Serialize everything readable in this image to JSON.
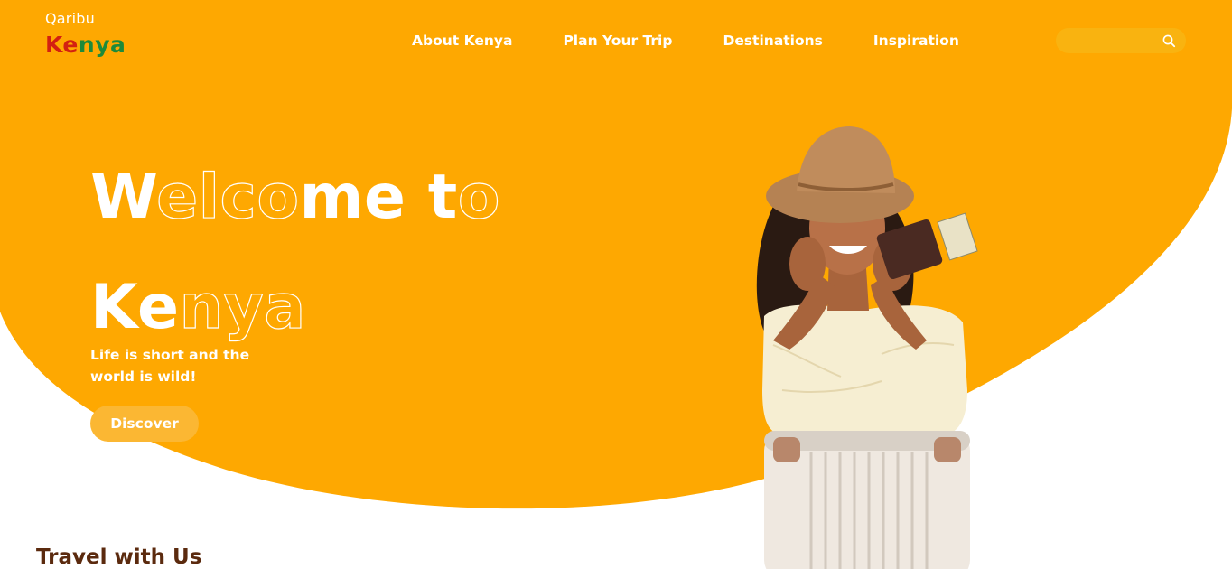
{
  "brand": {
    "tagline": "Qaribu",
    "name_part1": "Ke",
    "name_part2": "nya"
  },
  "nav": {
    "items": [
      {
        "label": "About Kenya"
      },
      {
        "label": "Plan Your Trip"
      },
      {
        "label": "Destinations"
      },
      {
        "label": "Inspiration"
      }
    ]
  },
  "search": {
    "placeholder": "",
    "icon": "search-icon"
  },
  "hero": {
    "title_line1": {
      "solid_start": "W",
      "outline_mid": "elco",
      "solid_mid": "me t",
      "outline_end": "o"
    },
    "title_line2": {
      "solid_start": "Ke",
      "outline_mid": "nya"
    },
    "subtitle": "Life is short and the world is wild!",
    "cta_label": "Discover",
    "image": "woman-with-hat-and-suitcase"
  },
  "section": {
    "title": "Travel with Us"
  },
  "colors": {
    "hero_orange": "#fea801",
    "search_bg": "#f9b310",
    "button_bg": "#fbb733",
    "brand_red": "#d32011",
    "brand_green": "#1e8a3a",
    "section_title": "#5b2a0e"
  }
}
